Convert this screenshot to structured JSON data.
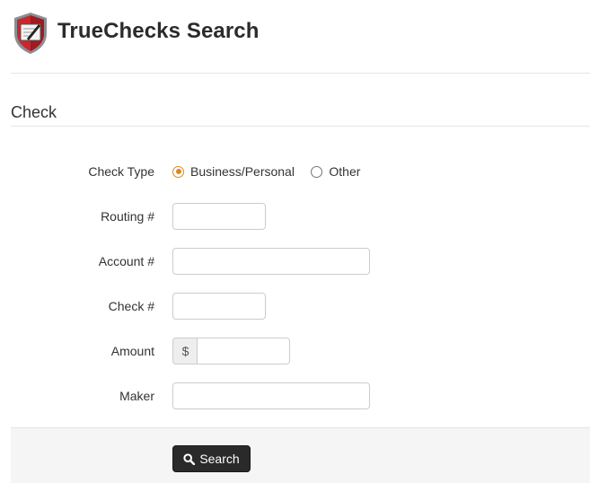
{
  "header": {
    "title": "TrueChecks Search"
  },
  "section": {
    "title": "Check"
  },
  "form": {
    "check_type": {
      "label": "Check Type",
      "options": [
        {
          "label": "Business/Personal",
          "selected": true
        },
        {
          "label": "Other",
          "selected": false
        }
      ]
    },
    "routing": {
      "label": "Routing #",
      "value": ""
    },
    "account": {
      "label": "Account #",
      "value": ""
    },
    "check_number": {
      "label": "Check #",
      "value": ""
    },
    "amount": {
      "label": "Amount",
      "prefix": "$",
      "value": ""
    },
    "maker": {
      "label": "Maker",
      "value": ""
    }
  },
  "actions": {
    "search_label": "Search",
    "search_icon": "search-icon"
  },
  "colors": {
    "accent": "#d98a1f",
    "button": "#2a2a2a",
    "footer_bg": "#f5f5f5"
  }
}
